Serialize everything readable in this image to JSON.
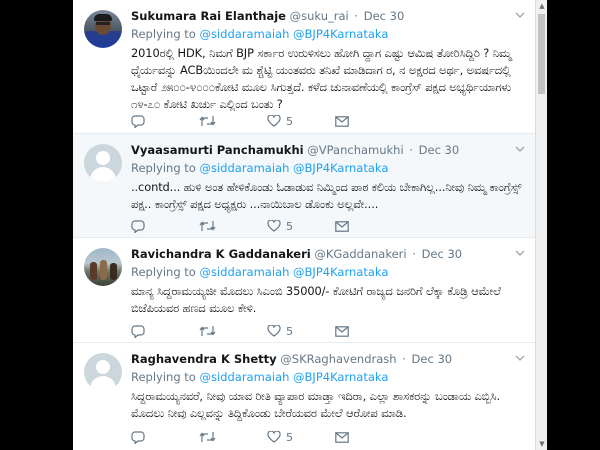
{
  "tweets": [
    {
      "name": "Sukumara Rai Elanthaje",
      "handle": "@suku_rai",
      "time": "Dec 30",
      "reply_prefix": "Replying to",
      "mention1": "@siddaramaiah",
      "mention2": "@BJP4Karnataka",
      "text": "2010ರಲ್ಲಿ HDK, ನಿಮಗೆ BJP ಸರ್ಕಾರ ಉರುಳಿಸಲು ಹೋಗಿ ದ್ದಾಗ ಎಷ್ಟು ಆಮಿಷ ತೋರಿಸಿದ್ದಿರಿ ? ನಿಮ್ಮ ಧೈರ್ಯವನ್ನು ACBಯಿಂದಲೇ ಮ ಶ್ಚೆಟ್ಟಿ ಯಂತವರು ತನಿಖೆ ಮಾಡಿದಾಗ ರ, ನ ಅಕ್ಷರದ ಅರ್ಥ, ಅವರ್ಷದಲ್ಲಿ ಒಟ್ಟಾರೆ ೨೫೦೦-೪೦೦೦ಕೋಟಿ ಮೂಲ ಸಿಗುತ್ತದೆ. ಕಳೆದ ಚುನಾವಣೆಯಲ್ಲಿ ಕಾಂಗ್ರೆಸ್ ಪಕ್ಷದ ಅಭ್ಯರ್ಥಿಯಾಗಳು ೧೪-೭೦ ಕೋಟಿ ಖರ್ಚು ಎಲ್ಲಿಂದ ಬಂತು ?",
      "likes": "5"
    },
    {
      "name": "Vyaasamurti Panchamukhi",
      "handle": "@VPanchamukhi",
      "time": "Dec 30",
      "reply_prefix": "Replying to",
      "mention1": "@siddaramaiah",
      "mention2": "@BJP4Karnataka",
      "text": "..contd... ಹುಳಿ ಅಂತ ಹೇಳಿಕೊಂಡು ಓಡಾಡುವ ನಿಮ್ಮಿಂದ ಪಾಠ ಕಲಿಯ ಬೇಕಾಗಿಲ್ಲ...ನೀವು ನಿಮ್ಮ ಕಾಂಗ್ರೆಸ್ಸ್ ಪಕ್ಷ.. ಕಾಂಗ್ರೆಸ್ಸ್ ಪಕ್ಷದ ಅಧ್ಯಕ್ಷರು ...ನಾಯಿಬಾಲ ಡೊಂಕು ಅಲ್ಲವೇ....",
      "likes": "5"
    },
    {
      "name": "Ravichandra K Gaddanakeri",
      "handle": "@KGaddanakeri",
      "time": "Dec 30",
      "reply_prefix": "Replying to",
      "mention1": "@siddaramaiah",
      "mention2": "@BJP4Karnataka",
      "text": "ಮಾನ್ಯ ಸಿದ್ದರಾಮಯ್ಯಜೀ ಮೊದಲು ಸಿಎಂಬಿ 35000/- ಕೋಟಿಗೆ ರಾಜ್ಯದ ಜನರಿಗೆ ಲೆಕ್ಕಾ ಕೊಡ್ರಿ ಆಮೇಲೆ ಬಿಜೆಪಿಯವರ ಹಣದ ಮೂಲ ಕೇಳಿ.",
      "likes": "5"
    },
    {
      "name": "Raghavendra K Shetty",
      "handle": "@SKRaghavendrash",
      "time": "Dec 30",
      "reply_prefix": "Replying to",
      "mention1": "@siddaramaiah",
      "mention2": "@BJP4Karnataka",
      "text": "ಸಿದ್ದರಾಮಯ್ಯನವರೆ, ನೀವು ಯಾವ ರೀತಿ ವ್ಯಾಪಾರ ಮಾಡ್ತಾ ಇದಿರಾ, ಎಲ್ಲಾ ಶಾಸಕರನ್ನು ಬಂಡಾಯ ಎಬ್ಬಿಸಿ. ಮೊದಲು ನೀವು ಎಲ್ಲವನ್ನು ತಿದ್ದಿಕೊಂಡು ಬೇರೆಯವರ ಮೇಲೆ ಆರೋಪ ಮಾಡಿ.",
      "likes": "5"
    }
  ],
  "icons": {
    "reply": "reply-icon",
    "retweet": "retweet-icon",
    "like": "heart-icon",
    "dm": "envelope-icon",
    "more": "chevron-down-icon"
  },
  "colors": {
    "link": "#1da1f2",
    "muted": "#657786",
    "text": "#14171a"
  }
}
